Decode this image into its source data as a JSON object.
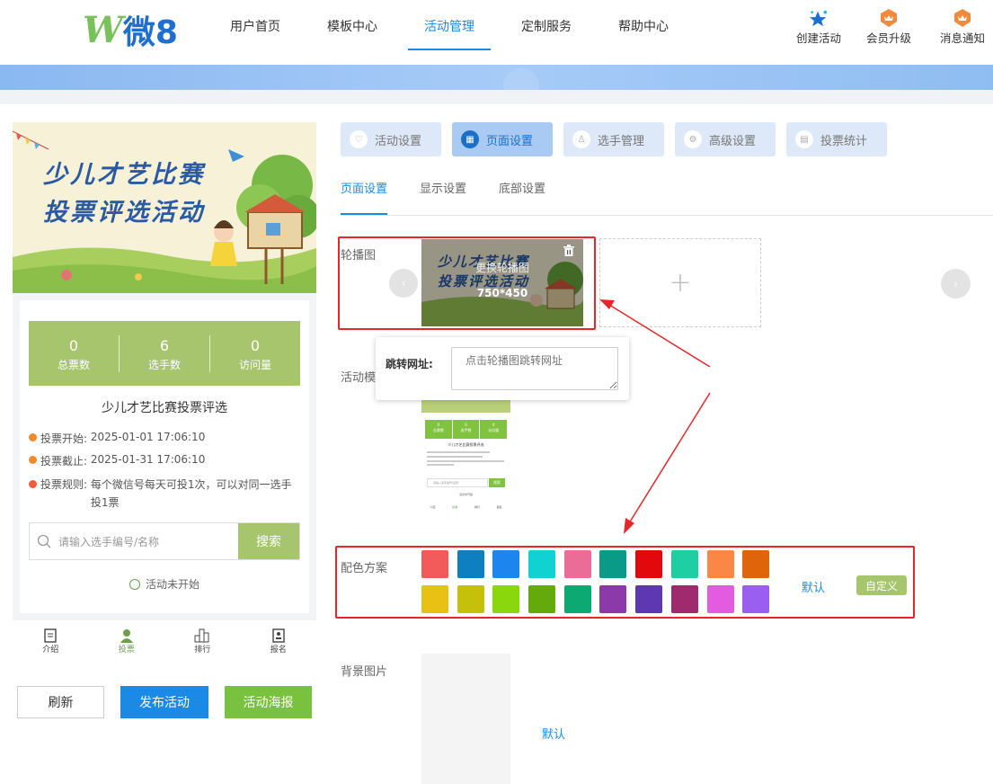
{
  "logo": {
    "w": "W",
    "text": "微8"
  },
  "nav": [
    {
      "label": "用户首页",
      "active": false
    },
    {
      "label": "模板中心",
      "active": false
    },
    {
      "label": "活动管理",
      "active": true
    },
    {
      "label": "定制服务",
      "active": false
    },
    {
      "label": "帮助中心",
      "active": false
    }
  ],
  "top_right": {
    "create": "创建活动",
    "upgrade": "会员升级",
    "notice": "消息通知"
  },
  "preview": {
    "poster_line1": "少儿才艺比赛",
    "poster_line2": "投票评选活动",
    "stats": [
      {
        "value": "0",
        "label": "总票数"
      },
      {
        "value": "6",
        "label": "选手数"
      },
      {
        "value": "0",
        "label": "访问量"
      }
    ],
    "title": "少儿才艺比赛投票评选",
    "start_label": "投票开始:",
    "start_value": "2025-01-01 17:06:10",
    "end_label": "投票截止:",
    "end_value": "2025-01-31 17:06:10",
    "rules_label": "投票规则:",
    "rules_value": "每个微信号每天可投1次，可以对同一选手投1票",
    "search_placeholder": "请输入选手编号/名称",
    "search_button": "搜索",
    "status": "活动未开始",
    "tabbar": [
      {
        "label": "介绍",
        "icon": "intro-icon",
        "active": false
      },
      {
        "label": "投票",
        "icon": "vote-icon",
        "active": true
      },
      {
        "label": "排行",
        "icon": "rank-icon",
        "active": false
      },
      {
        "label": "报名",
        "icon": "signup-icon",
        "active": false
      }
    ]
  },
  "actions": {
    "refresh": "刷新",
    "publish": "发布活动",
    "poster": "活动海报"
  },
  "segments": [
    {
      "label": "活动设置",
      "icon": "heart-icon",
      "active": false
    },
    {
      "label": "页面设置",
      "icon": "page-icon",
      "active": true
    },
    {
      "label": "选手管理",
      "icon": "user-icon",
      "active": false
    },
    {
      "label": "高级设置",
      "icon": "advanced-icon",
      "active": false
    },
    {
      "label": "投票统计",
      "icon": "stats-icon",
      "active": false
    }
  ],
  "subtabs": [
    {
      "label": "页面设置",
      "active": true
    },
    {
      "label": "显示设置",
      "active": false
    },
    {
      "label": "底部设置",
      "active": false
    }
  ],
  "fields": {
    "carousel": "轮播图",
    "carousel_replace": "更换轮播图",
    "carousel_size": "750*450",
    "template": "活动模",
    "jump_label": "跳转网址:",
    "jump_placeholder": "点击轮播图跳转网址",
    "color_scheme": "配色方案",
    "default": "默认",
    "custom": "自定义",
    "bg_image": "背景图片",
    "bg_default": "默认"
  },
  "mini_preview": {
    "stats": [
      {
        "value": "0",
        "label": "总票数"
      },
      {
        "value": "6",
        "label": "选手数"
      },
      {
        "value": "0",
        "label": "访问量"
      }
    ],
    "title": "少儿才艺比赛投票评选",
    "search_placeholder": "请输入选手编号/名称",
    "search_button": "搜索",
    "status": "活动未开始",
    "tabs": [
      "介绍",
      "投票",
      "排行",
      "报名"
    ]
  },
  "colors": {
    "accent": "#1a8ae6",
    "preview_green": "#a6c56c",
    "swatches": [
      "#f35b5b",
      "#0e7fc0",
      "#1c85ee",
      "#10d2d2",
      "#ec6c98",
      "#0a9a88",
      "#e2080c",
      "#1ecfa3",
      "#fb8747",
      "#e0650a",
      "#e9c014",
      "#c5c10a",
      "#8ad70e",
      "#64aa0a",
      "#0caa72",
      "#8c3aa9",
      "#5e37b3",
      "#a02a6e",
      "#e35ce0",
      "#9a5ff0"
    ]
  }
}
